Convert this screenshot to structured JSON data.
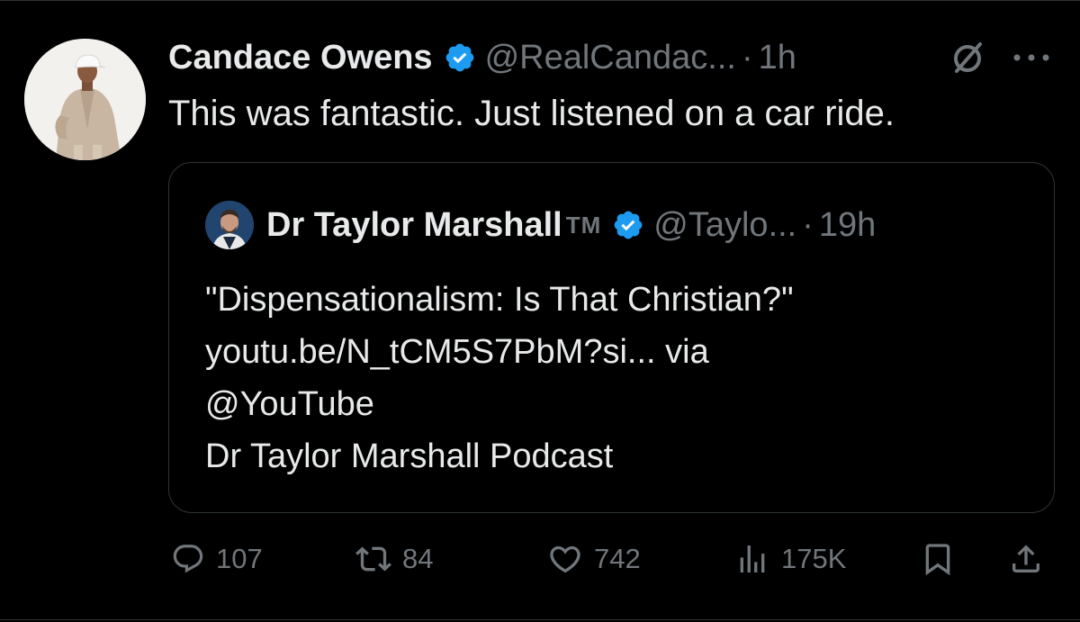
{
  "tweet": {
    "display_name": "Candace Owens",
    "handle": "@RealCandac...",
    "separator": "·",
    "time": "1h",
    "text": "This was fantastic. Just listened on a car ride."
  },
  "quote": {
    "display_name": "Dr Taylor Marshall",
    "tm": "TM",
    "handle": "@Taylo...",
    "separator": "·",
    "time": "19h",
    "lines": [
      "\"Dispensationalism: Is That Christian?\"",
      "youtu.be/N_tCM5S7PbM?si... via",
      "@YouTube",
      "Dr Taylor Marshall Podcast"
    ]
  },
  "actions": {
    "replies": "107",
    "reposts": "84",
    "likes": "742",
    "views": "175K"
  },
  "icons": [
    "verified-badge-icon",
    "grok-icon",
    "more-icon",
    "reply-icon",
    "repost-icon",
    "like-icon",
    "views-icon",
    "bookmark-icon",
    "share-icon"
  ],
  "colors": {
    "background": "#000000",
    "text": "#e7e9ea",
    "secondary": "#71767b",
    "verified": "#1d9bf0",
    "border": "#2f3336"
  }
}
